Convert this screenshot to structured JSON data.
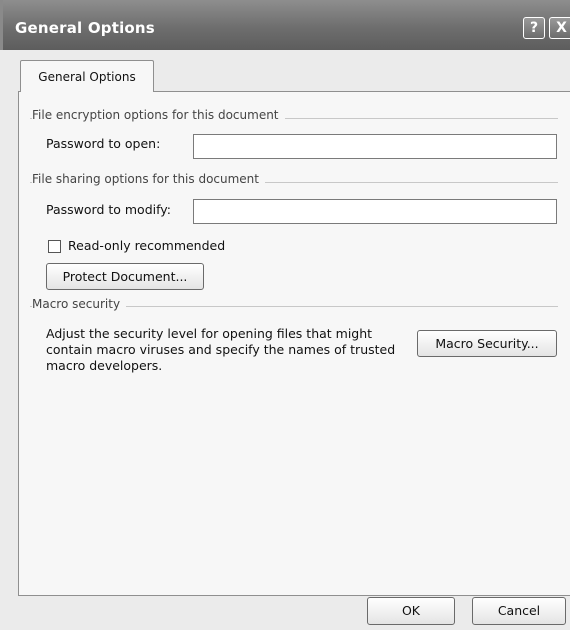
{
  "window": {
    "title": "General Options",
    "help_glyph": "?",
    "close_glyph": "X"
  },
  "tab": {
    "label": "General Options"
  },
  "encryption": {
    "group_label": "File encryption options for this document",
    "password_open_label": "Password to open:",
    "password_open_value": ""
  },
  "sharing": {
    "group_label": "File sharing options for this document",
    "password_modify_label": "Password to modify:",
    "password_modify_value": "",
    "readonly_label": "Read-only recommended",
    "readonly_checked": false,
    "protect_button": "Protect Document..."
  },
  "macro": {
    "group_label": "Macro security",
    "description": "Adjust the security level for opening files that might contain macro viruses and specify the names of trusted macro developers.",
    "button": "Macro Security..."
  },
  "footer": {
    "ok": "OK",
    "cancel": "Cancel"
  }
}
